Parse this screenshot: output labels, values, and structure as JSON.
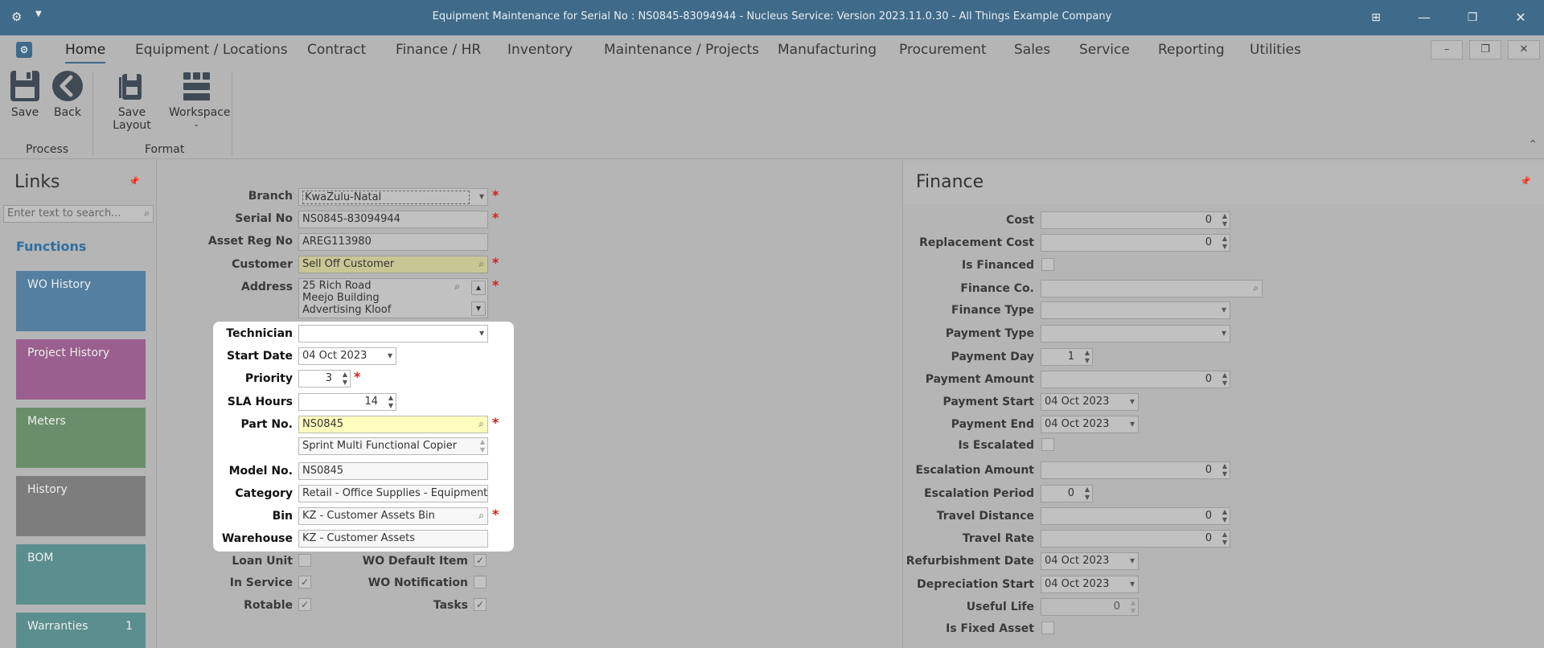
{
  "window": {
    "title": "Equipment Maintenance for Serial No : NS0845-83094944 - Nucleus Service: Version 2023.11.0.30 - All Things Example Company"
  },
  "menu": [
    "Home",
    "Equipment / Locations",
    "Contract",
    "Finance / HR",
    "Inventory",
    "Maintenance / Projects",
    "Manufacturing",
    "Procurement",
    "Sales",
    "Service",
    "Reporting",
    "Utilities"
  ],
  "ribbon": {
    "save": "Save",
    "back": "Back",
    "save_layout": "Save Layout",
    "workspace": "Workspace",
    "group_process": "Process",
    "group_format": "Format"
  },
  "links": {
    "title": "Links",
    "search_placeholder": "Enter text to search...",
    "functions": "Functions",
    "tiles": [
      {
        "label": "WO History",
        "color": "#547fa0",
        "count": ""
      },
      {
        "label": "Project History",
        "color": "#9a5f8e",
        "count": ""
      },
      {
        "label": "Meters",
        "color": "#6a8e6a",
        "count": ""
      },
      {
        "label": "History",
        "color": "#7d7d7d",
        "count": ""
      },
      {
        "label": "BOM",
        "color": "#5b8e8e",
        "count": ""
      },
      {
        "label": "Warranties",
        "color": "#5b8e8e",
        "count": "1"
      }
    ]
  },
  "form": {
    "branch": {
      "label": "Branch",
      "value": "KwaZulu-Natal"
    },
    "serial_no": {
      "label": "Serial No",
      "value": "NS0845-83094944"
    },
    "asset_reg_no": {
      "label": "Asset Reg No",
      "value": "AREG113980"
    },
    "customer": {
      "label": "Customer",
      "value": "Sell Off Customer"
    },
    "address": {
      "label": "Address",
      "line1": "25 Rich Road",
      "line2": "Meejo Building",
      "line3": "Advertising Kloof"
    },
    "technician": {
      "label": "Technician",
      "value": ""
    },
    "start_date": {
      "label": "Start Date",
      "value": "04 Oct 2023"
    },
    "priority": {
      "label": "Priority",
      "value": "3"
    },
    "sla_hours": {
      "label": "SLA Hours",
      "value": "14"
    },
    "part_no": {
      "label": "Part No.",
      "value": "NS0845"
    },
    "part_desc": "Sprint Multi Functional Copier",
    "model_no": {
      "label": "Model No.",
      "value": "NS0845"
    },
    "category": {
      "label": "Category",
      "value": "Retail - Office Supplies - Equipment"
    },
    "bin": {
      "label": "Bin",
      "value": "KZ - Customer Assets Bin"
    },
    "warehouse": {
      "label": "Warehouse",
      "value": "KZ - Customer Assets"
    },
    "loan_unit": {
      "label": "Loan Unit",
      "checked": false
    },
    "in_service": {
      "label": "In Service",
      "checked": true
    },
    "rotable": {
      "label": "Rotable",
      "checked": true
    },
    "wo_default_item": {
      "label": "WO Default Item",
      "checked": true
    },
    "wo_notification": {
      "label": "WO Notification",
      "checked": false
    },
    "tasks": {
      "label": "Tasks",
      "checked": true
    }
  },
  "finance": {
    "title": "Finance",
    "cost": {
      "label": "Cost",
      "value": "0"
    },
    "replacement_cost": {
      "label": "Replacement Cost",
      "value": "0"
    },
    "is_financed": {
      "label": "Is Financed",
      "checked": false
    },
    "finance_co": {
      "label": "Finance Co.",
      "value": ""
    },
    "finance_type": {
      "label": "Finance Type",
      "value": ""
    },
    "payment_type": {
      "label": "Payment Type",
      "value": ""
    },
    "payment_day": {
      "label": "Payment Day",
      "value": "1"
    },
    "payment_amount": {
      "label": "Payment Amount",
      "value": "0"
    },
    "payment_start": {
      "label": "Payment Start",
      "value": "04 Oct 2023"
    },
    "payment_end": {
      "label": "Payment End",
      "value": "04 Oct 2023"
    },
    "is_escalated": {
      "label": "Is Escalated",
      "checked": false
    },
    "escalation_amount": {
      "label": "Escalation Amount",
      "value": "0"
    },
    "escalation_period": {
      "label": "Escalation Period",
      "value": "0"
    },
    "travel_distance": {
      "label": "Travel Distance",
      "value": "0"
    },
    "travel_rate": {
      "label": "Travel Rate",
      "value": "0"
    },
    "refurbishment_date": {
      "label": "Refurbishment Date",
      "value": "04 Oct 2023"
    },
    "depreciation_start": {
      "label": "Depreciation Start",
      "value": "04 Oct 2023"
    },
    "useful_life": {
      "label": "Useful Life",
      "value": "0"
    },
    "is_fixed_asset": {
      "label": "Is Fixed Asset",
      "checked": false
    }
  }
}
